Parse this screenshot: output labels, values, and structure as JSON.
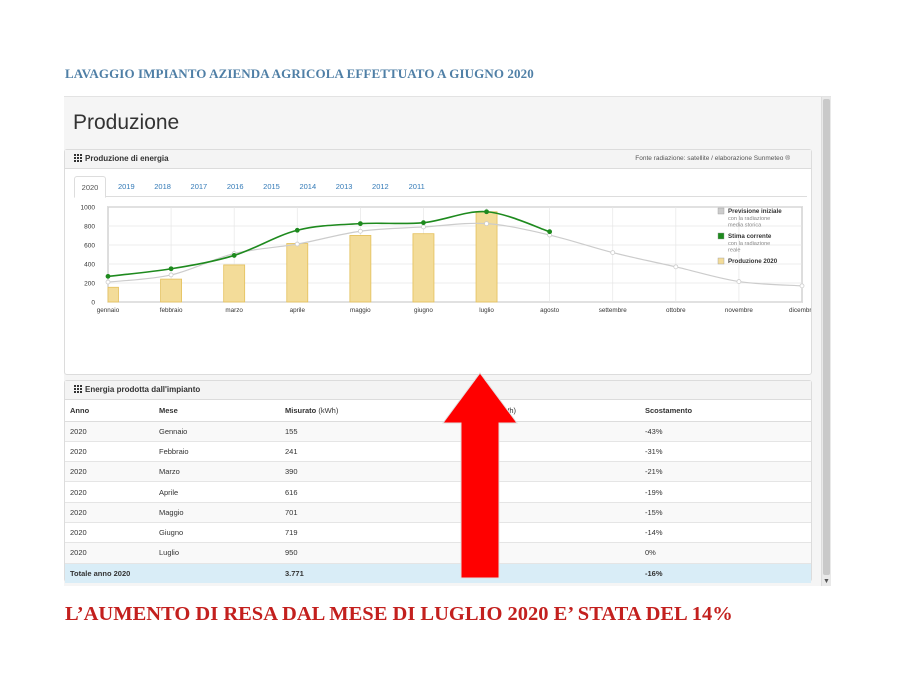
{
  "document": {
    "heading": "LAVAGGIO IMPIANTO AZIENDA AGRICOLA EFFETTUATO A GIUGNO 2020",
    "footer": "L’AUMENTO DI RESA DAL MESE DI LUGLIO 2020 E’ STATA DEL 14%",
    "heading_color": "#4f7fa6",
    "footer_color": "#c3201e",
    "arrow_color": "#ff0000"
  },
  "app": {
    "title": "Produzione",
    "energy_panel": {
      "title": "Produzione di energia",
      "source_note": "Fonte radiazione: satellite / elaborazione Sunmeteo ®",
      "icon": "grid-icon"
    },
    "year_tabs": [
      "2020",
      "2019",
      "2018",
      "2017",
      "2016",
      "2015",
      "2014",
      "2013",
      "2012",
      "2011"
    ],
    "active_year": "2020",
    "table_panel": {
      "title": "Energia prodotta dall'impianto",
      "icon": "grid-icon",
      "columns": {
        "anno": "Anno",
        "mese": "Mese",
        "misurato": "Misurato",
        "misurato_unit": "(kWh)",
        "previsto_unit": "(kWh)",
        "scostamento": "Scostamento"
      },
      "rows": [
        {
          "anno": "2020",
          "mese": "Gennaio",
          "misurato": "155",
          "scostamento": "-43%"
        },
        {
          "anno": "2020",
          "mese": "Febbraio",
          "misurato": "241",
          "scostamento": "-31%"
        },
        {
          "anno": "2020",
          "mese": "Marzo",
          "misurato": "390",
          "scostamento": "-21%"
        },
        {
          "anno": "2020",
          "mese": "Aprile",
          "misurato": "616",
          "scostamento": "-19%"
        },
        {
          "anno": "2020",
          "mese": "Maggio",
          "misurato": "701",
          "scostamento": "-15%"
        },
        {
          "anno": "2020",
          "mese": "Giugno",
          "misurato": "719",
          "scostamento": "-14%"
        },
        {
          "anno": "2020",
          "mese": "Luglio",
          "misurato": "950",
          "scostamento": "0%"
        }
      ],
      "total": {
        "label": "Totale anno 2020",
        "misurato": "3.771",
        "scostamento": "-16%"
      }
    }
  },
  "chart_data": {
    "type": "bar",
    "categories": [
      "gennaio",
      "febbraio",
      "marzo",
      "aprile",
      "maggio",
      "giugno",
      "luglio",
      "agosto",
      "settembre",
      "ottobre",
      "novembre",
      "dicembre"
    ],
    "ylim": [
      0,
      1000
    ],
    "yticks": [
      0,
      200,
      400,
      600,
      800,
      1000
    ],
    "grid": true,
    "legend_placement": "top-right",
    "legend": [
      {
        "name": "Previsione iniziale",
        "sub": [
          "con la radiazione",
          "media storica"
        ],
        "color": "#cccccc"
      },
      {
        "name": "Stima corrente",
        "sub": [
          "con la radiazione",
          "reale"
        ],
        "color": "#1e8a1e"
      },
      {
        "name": "Produzione 2020",
        "sub": [],
        "color": "#f3dc99"
      }
    ],
    "series": [
      {
        "name": "Produzione 2020",
        "kind": "bar",
        "color": "#f3dc99",
        "values": [
          155,
          241,
          390,
          616,
          701,
          719,
          950,
          null,
          null,
          null,
          null,
          null
        ]
      },
      {
        "name": "Stima corrente",
        "kind": "line",
        "color": "#1e8a1e",
        "values": [
          270,
          350,
          490,
          755,
          825,
          835,
          950,
          740,
          null,
          null,
          null,
          null
        ]
      },
      {
        "name": "Previsione iniziale",
        "kind": "line",
        "color": "#cccccc",
        "values": [
          210,
          285,
          510,
          610,
          745,
          790,
          825,
          705,
          520,
          370,
          215,
          170
        ]
      }
    ]
  }
}
